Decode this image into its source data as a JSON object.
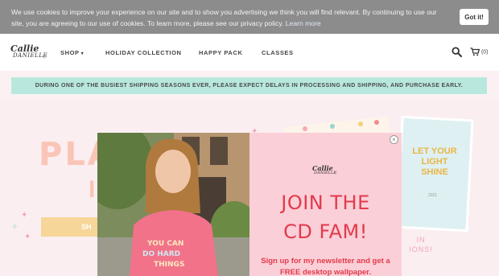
{
  "cookie": {
    "text": "We use cookies to improve your experience on our site and to show you advertising we think you will find relevant. By continuing to use our site, you are agreeing to our use of cookies. To learn more, please see our privacy policy.",
    "link": "Learn more",
    "button": "Got it!"
  },
  "header": {
    "logo_line1": "Callie",
    "logo_line2": "DANIELLE",
    "nav": {
      "shop": "SHOP",
      "holiday": "HOLIDAY COLLECTION",
      "happy": "HAPPY PACK",
      "classes": "CLASSES"
    },
    "cart_count": "(0)"
  },
  "banner": {
    "text": "DURING ONE OF THE BUSIEST SHIPPING SEASONS EVER, PLEASE EXPECT DELAYS IN PROCESSING AND SHIPPING, AND PURCHASE EARLY."
  },
  "hero": {
    "headline_part": "PLA",
    "headline_part2": "I",
    "button_part": "SH",
    "card_text": "LET YOUR LIGHT SHINE",
    "card_year": "2021",
    "side_text": "IN IONS!"
  },
  "modal": {
    "close": "×",
    "logo_line1": "Callie",
    "logo_line2": "DANIELLE",
    "title_line1": "JOIN THE",
    "title_line2": "CD FAM!",
    "subtitle": "Sign up for my newsletter and get a FREE desktop wallpaper."
  },
  "colors": {
    "cookie_bg": "#8c8c8c",
    "banner_bg": "#b8e8dd",
    "modal_panel": "#fbcfd7",
    "modal_text": "#e23a4c",
    "hero_bg": "#fbeef1"
  }
}
